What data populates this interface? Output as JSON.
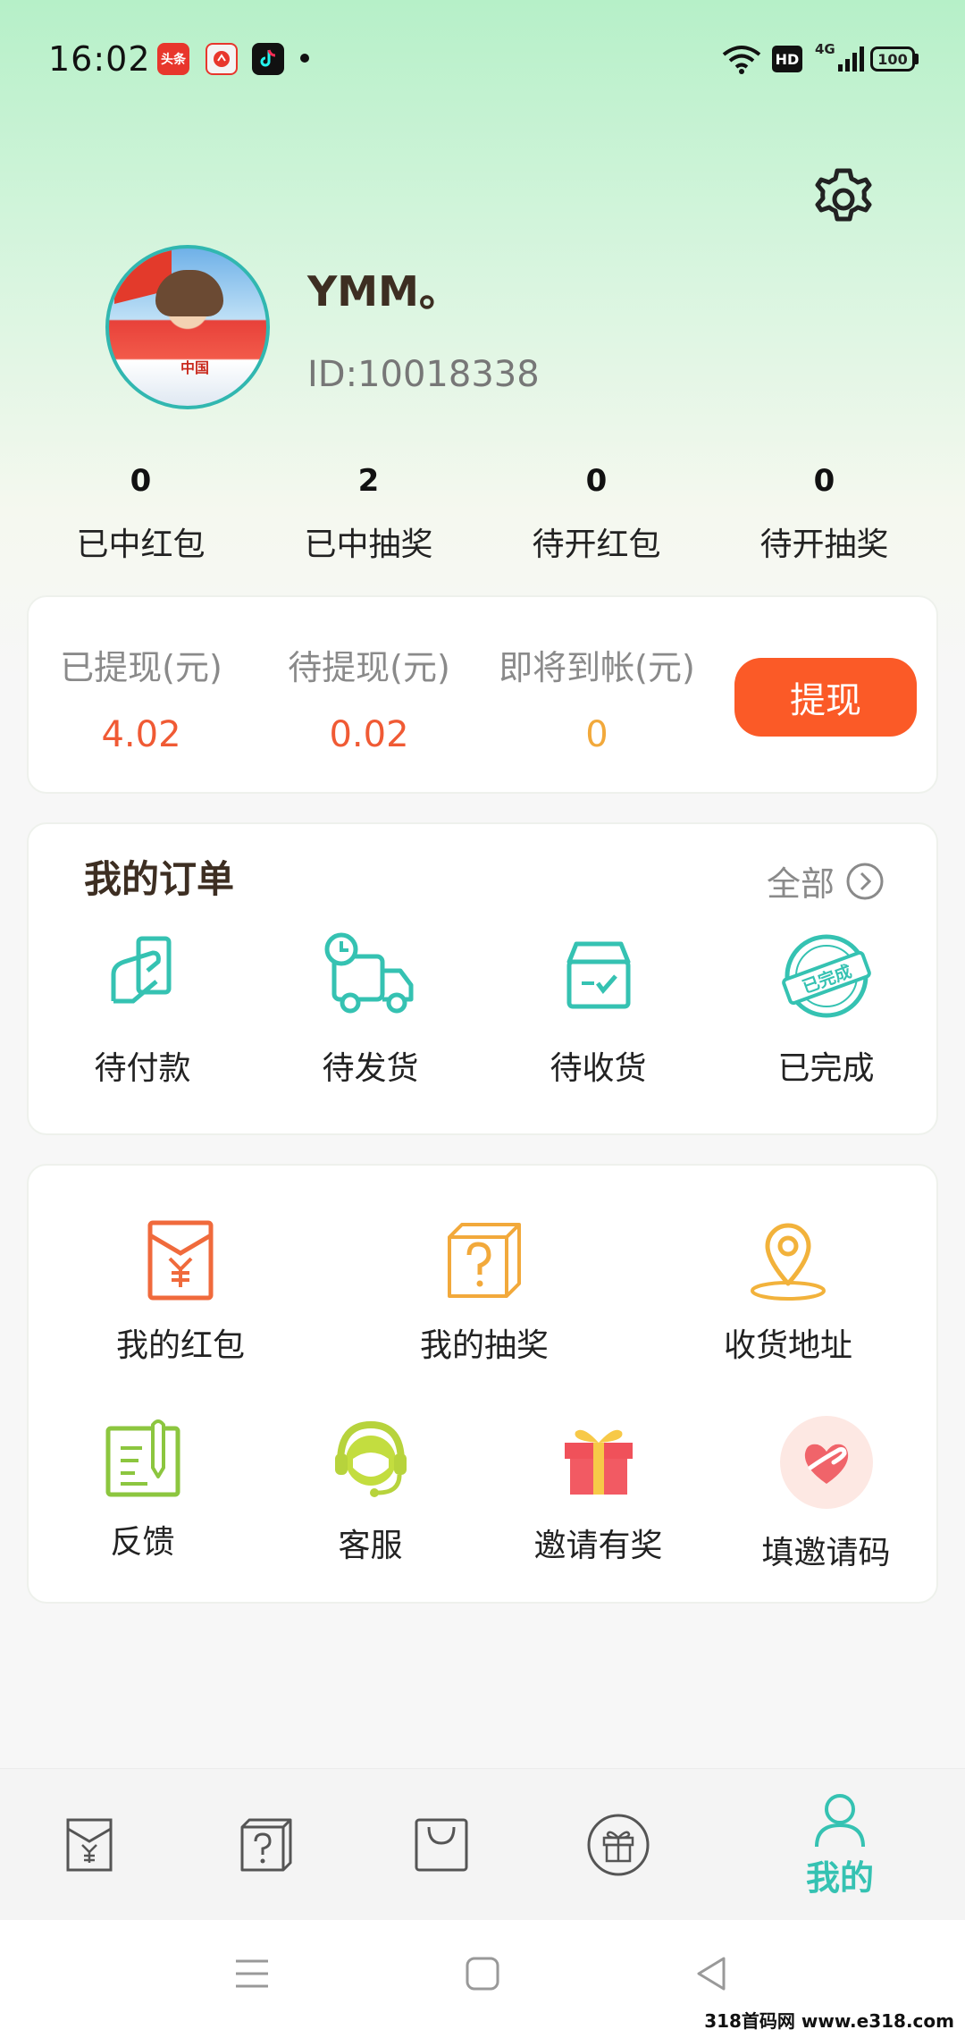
{
  "status_bar": {
    "time": "16:02",
    "apps": [
      "头条",
      "",
      ""
    ],
    "network": "4G",
    "signal_label": "HD",
    "battery": "100"
  },
  "profile": {
    "username": "YMM。",
    "user_id": "ID:10018338",
    "avatar_text": "中国"
  },
  "stats": [
    {
      "value": "0",
      "label": "已中红包"
    },
    {
      "value": "2",
      "label": "已中抽奖"
    },
    {
      "value": "0",
      "label": "待开红包"
    },
    {
      "value": "0",
      "label": "待开抽奖"
    }
  ],
  "wallet": {
    "items": [
      {
        "label": "已提现(元)",
        "value": "4.02",
        "color": "#f05a34"
      },
      {
        "label": "待提现(元)",
        "value": "0.02",
        "color": "#f05a34"
      },
      {
        "label": "即将到帐(元)",
        "value": "0",
        "color": "#f2a93b"
      }
    ],
    "withdraw_label": "提现"
  },
  "orders": {
    "title": "我的订单",
    "all_label": "全部",
    "items": [
      {
        "label": "待付款",
        "icon": "payment-icon"
      },
      {
        "label": "待发货",
        "icon": "truck-icon"
      },
      {
        "label": "待收货",
        "icon": "package-check-icon"
      },
      {
        "label": "已完成",
        "icon": "completed-stamp-icon",
        "stamp_text": "已完成"
      }
    ]
  },
  "tools": {
    "row1": [
      {
        "label": "我的红包",
        "icon": "red-envelope-icon"
      },
      {
        "label": "我的抽奖",
        "icon": "mystery-box-icon"
      },
      {
        "label": "收货地址",
        "icon": "location-pin-icon"
      }
    ],
    "row2": [
      {
        "label": "反馈",
        "icon": "feedback-icon"
      },
      {
        "label": "客服",
        "icon": "customer-service-icon"
      },
      {
        "label": "邀请有奖",
        "icon": "gift-icon"
      },
      {
        "label": "填邀请码",
        "icon": "heart-hand-icon"
      }
    ]
  },
  "tabbar": {
    "active_label": "我的",
    "active_color": "#35c2b2"
  },
  "colors": {
    "accent": "#35c2b2",
    "withdraw_button": "#fb5a27",
    "header_gradient": "#b6f0c8"
  },
  "watermark": "318首码网 www.e318.com"
}
